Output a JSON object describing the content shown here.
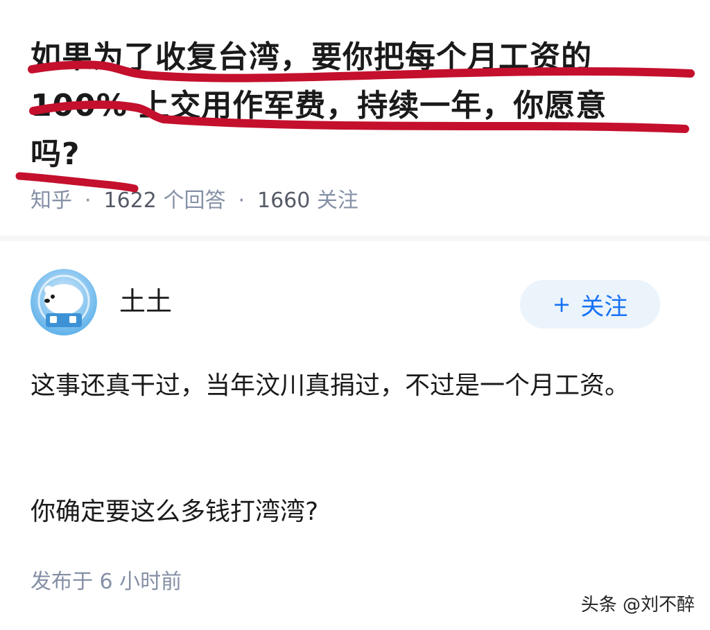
{
  "question": {
    "title": "如果为了收复台湾，要你把每个月工资的100% 上交用作军费，持续一年，你愿意吗?",
    "source": "知乎",
    "answer_count": "1622",
    "answer_label": "个回答",
    "follower_count": "1660",
    "follower_label": "关注",
    "separator": "·"
  },
  "answer": {
    "author": "土土",
    "follow_plus": "+",
    "follow_label": "关注",
    "paragraphs": [
      "这事还真干过，当年汶川真捐过，不过是一个月工资。",
      "你确定要这么多钱打湾湾?"
    ],
    "published": "发布于 6 小时前"
  },
  "watermark": "头条 @刘不醉",
  "colors": {
    "highlight_scribble": "#c4102d",
    "accent": "#1772f6",
    "muted": "#8590a6"
  },
  "icons": {
    "avatar": "polar-bear-avatar",
    "scribble": "red-marker-underline"
  }
}
